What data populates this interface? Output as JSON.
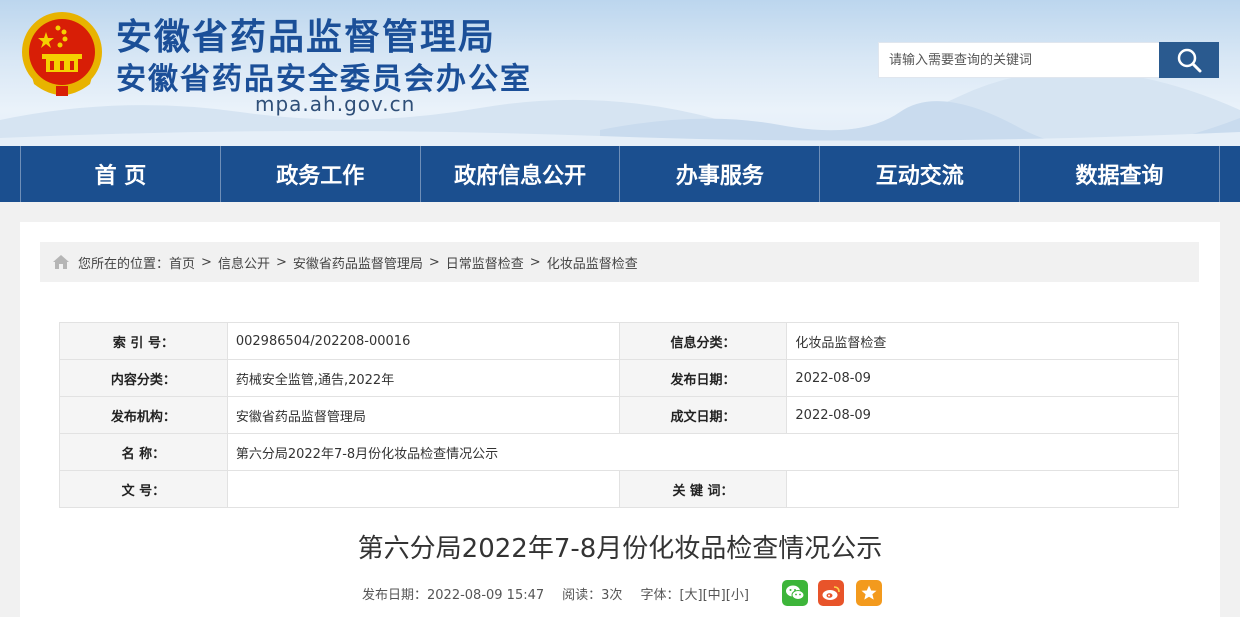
{
  "header": {
    "title_line1": "安徽省药品监督管理局",
    "title_line2": "安徽省药品安全委员会办公室",
    "domain": "mpa.ah.gov.cn",
    "search_placeholder": "请输入需要查询的关键词",
    "colors": {
      "title": "#1b4f98",
      "search_button": "#2a5a8f"
    }
  },
  "nav": {
    "items": [
      "首 页",
      "政务工作",
      "政府信息公开",
      "办事服务",
      "互动交流",
      "数据查询"
    ],
    "color": "#1b4f8f"
  },
  "breadcrumb": {
    "prefix": "您所在的位置：",
    "items": [
      "首页",
      "信息公开",
      "安徽省药品监督管理局",
      "日常监督检查",
      "化妆品监督检查"
    ],
    "separator": ">"
  },
  "info": {
    "index_label": "索  引  号：",
    "index_value": "002986504/202208-00016",
    "category_label": "信息分类：",
    "category_value": "化妆品监督检查",
    "content_label": "内容分类：",
    "content_value": "药械安全监管,通告,2022年",
    "publish_date_label": "发布日期：",
    "publish_date_value": "2022-08-09",
    "org_label": "发布机构：",
    "org_value": "安徽省药品监督管理局",
    "written_date_label": "成文日期：",
    "written_date_value": "2022-08-09",
    "name_label": "名      称：",
    "name_value": "第六分局2022年7-8月份化妆品检查情况公示",
    "doc_no_label": "文      号：",
    "doc_no_value": "",
    "keywords_label": "关  键  词：",
    "keywords_value": ""
  },
  "article": {
    "title": "第六分局2022年7-8月份化妆品检查情况公示",
    "publish": "发布日期：2022-08-09 15:47",
    "reads": "阅读：3次",
    "font_label": "字体：",
    "font_large": "[大]",
    "font_medium": "[中]",
    "font_small": "[小]",
    "share_icons": [
      "wechat-icon",
      "weibo-icon",
      "favorite-icon"
    ]
  }
}
